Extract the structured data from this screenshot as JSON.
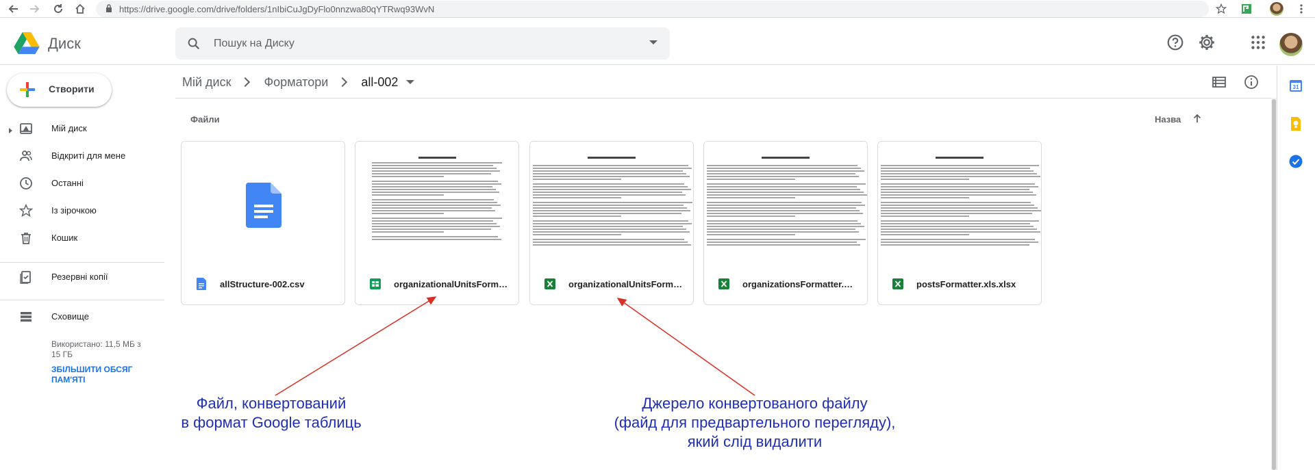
{
  "browser": {
    "url": "https://drive.google.com/drive/folders/1nIbiCuJgDyFlo0nnzwa80qYTRwq93WvN"
  },
  "app": {
    "name": "Диск"
  },
  "search": {
    "placeholder": "Пошук на Диску"
  },
  "sidebar": {
    "new_label": "Створити",
    "items": [
      {
        "label": "Мій диск",
        "icon": "my-drive-icon"
      },
      {
        "label": "Відкриті для мене",
        "icon": "shared-with-me-icon"
      },
      {
        "label": "Останні",
        "icon": "clock-icon"
      },
      {
        "label": "Із зірочкою",
        "icon": "star-icon"
      },
      {
        "label": "Кошик",
        "icon": "trash-icon"
      },
      {
        "label": "Резервні копії",
        "icon": "backups-icon"
      },
      {
        "label": "Сховище",
        "icon": "storage-icon"
      }
    ],
    "storage_text": "Використано: 11,5 МБ з 15 ГБ",
    "storage_link": "ЗБІЛЬШИТИ ОБСЯГ ПАМ'ЯТІ"
  },
  "breadcrumb": [
    "Мій диск",
    "Форматори",
    "all-002"
  ],
  "main": {
    "files_heading": "Файли",
    "sort_label": "Назва"
  },
  "files": [
    {
      "name": "allStructure-002.csv",
      "type": "docs"
    },
    {
      "name": "organizationalUnitsFormatt…",
      "type": "sheets"
    },
    {
      "name": "organizationalUnitsFormatt…",
      "type": "excel"
    },
    {
      "name": "organizationsFormatter.xls.…",
      "type": "excel"
    },
    {
      "name": "postsFormatter.xls.xlsx",
      "type": "excel"
    }
  ],
  "thumb_title": "Призначення форматору",
  "annotations": {
    "left": [
      "Файл, конвертований",
      "в формат Google таблиць"
    ],
    "right": [
      "Джерело конвертованого файлу",
      "(файд для предвартельного перегляду),",
      "який слід видалити"
    ]
  },
  "colors": {
    "annotation": "#1f2fb3",
    "arrow": "#d93025",
    "docs_blue": "#4285f4",
    "sheets_green": "#0f9d58",
    "excel_green": "#188038"
  }
}
